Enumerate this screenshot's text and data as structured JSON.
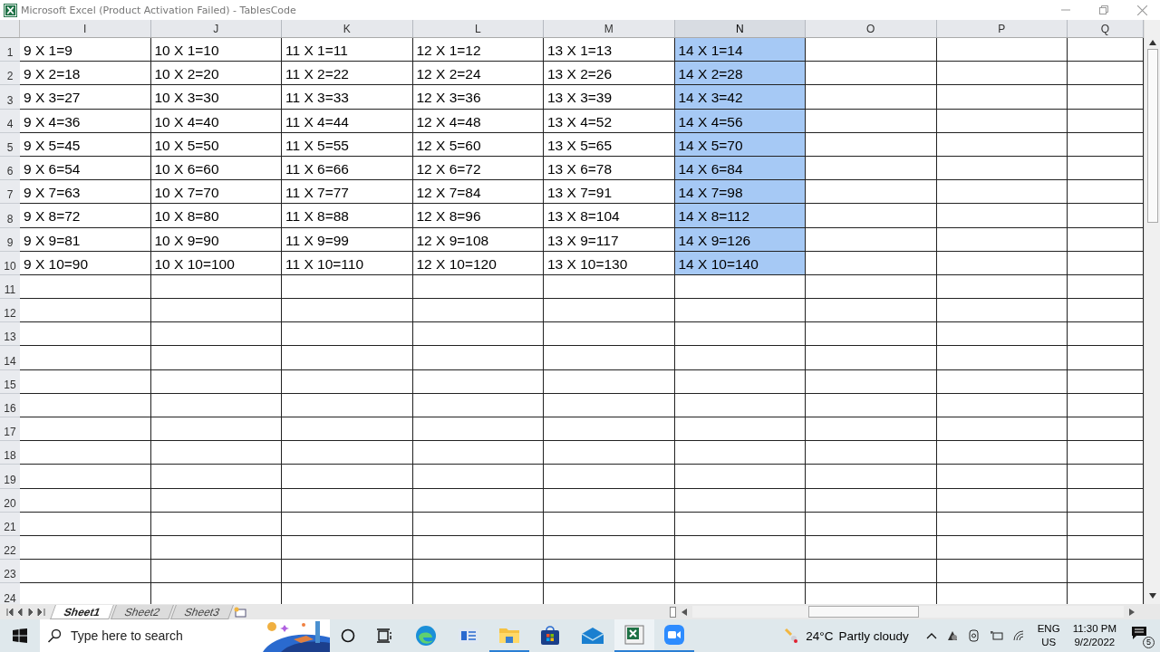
{
  "window": {
    "title": "Microsoft Excel (Product Activation Failed) - TablesCode"
  },
  "columns": [
    {
      "label": "I",
      "selected": false
    },
    {
      "label": "J",
      "selected": false
    },
    {
      "label": "K",
      "selected": false
    },
    {
      "label": "L",
      "selected": false
    },
    {
      "label": "M",
      "selected": false
    },
    {
      "label": "N",
      "selected": true
    },
    {
      "label": "O",
      "selected": false
    },
    {
      "label": "P",
      "selected": false
    },
    {
      "label": "Q",
      "selected": false
    }
  ],
  "rows": [
    {
      "number": "1",
      "cells": [
        "9 X 1=9",
        "10 X 1=10",
        "11 X 1=11",
        "12 X 1=12",
        "13 X 1=13",
        "14 X 1=14"
      ]
    },
    {
      "number": "2",
      "cells": [
        "9 X 2=18",
        "10 X 2=20",
        "11 X 2=22",
        "12 X 2=24",
        "13 X 2=26",
        "14 X 2=28"
      ]
    },
    {
      "number": "3",
      "cells": [
        "9 X 3=27",
        "10 X 3=30",
        "11 X 3=33",
        "12 X 3=36",
        "13 X 3=39",
        "14 X 3=42"
      ]
    },
    {
      "number": "4",
      "cells": [
        "9 X 4=36",
        "10 X 4=40",
        "11 X 4=44",
        "12 X 4=48",
        "13 X 4=52",
        "14 X 4=56"
      ]
    },
    {
      "number": "5",
      "cells": [
        "9 X 5=45",
        "10 X 5=50",
        "11 X 5=55",
        "12 X 5=60",
        "13 X 5=65",
        "14 X 5=70"
      ]
    },
    {
      "number": "6",
      "cells": [
        "9 X 6=54",
        "10 X 6=60",
        "11 X 6=66",
        "12 X 6=72",
        "13 X 6=78",
        "14 X 6=84"
      ]
    },
    {
      "number": "7",
      "cells": [
        "9 X 7=63",
        "10 X 7=70",
        "11 X 7=77",
        "12 X 7=84",
        "13 X 7=91",
        "14 X 7=98"
      ]
    },
    {
      "number": "8",
      "cells": [
        "9 X 8=72",
        "10 X 8=80",
        "11 X 8=88",
        "12 X 8=96",
        "13 X 8=104",
        "14 X 8=112"
      ]
    },
    {
      "number": "9",
      "cells": [
        "9 X 9=81",
        "10 X 9=90",
        "11 X 9=99",
        "12 X 9=108",
        "13 X 9=117",
        "14 X 9=126"
      ]
    },
    {
      "number": "10",
      "cells": [
        "9 X 10=90",
        "10 X 10=100",
        "11 X 10=110",
        "12 X 10=120",
        "13 X 10=130",
        "14 X 10=140"
      ]
    },
    {
      "number": "11"
    },
    {
      "number": "12"
    },
    {
      "number": "13"
    },
    {
      "number": "14"
    },
    {
      "number": "15"
    },
    {
      "number": "16"
    },
    {
      "number": "17"
    },
    {
      "number": "18"
    },
    {
      "number": "19"
    },
    {
      "number": "20"
    },
    {
      "number": "21"
    },
    {
      "number": "22"
    },
    {
      "number": "23"
    },
    {
      "number": "24"
    }
  ],
  "sheet_tabs": [
    {
      "label": "Sheet1",
      "selected": true
    },
    {
      "label": "Sheet2",
      "selected": false
    },
    {
      "label": "Sheet3",
      "selected": false
    }
  ],
  "taskbar": {
    "search": {
      "placeholder": "Type here to search"
    },
    "weather": {
      "temperature": "24°C",
      "condition": "Partly cloudy"
    },
    "language": {
      "code": "ENG",
      "region": "US"
    },
    "clock": {
      "time": "11:30 PM",
      "date": "9/2/2022"
    },
    "notifications": "5"
  }
}
